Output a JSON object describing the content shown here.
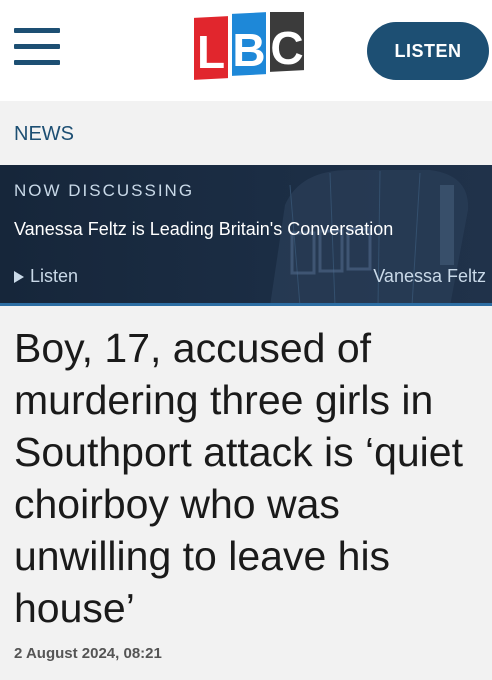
{
  "header": {
    "logo_letters": [
      "L",
      "B",
      "C"
    ],
    "listen_label": "LISTEN",
    "brand_colors": {
      "l": "#e1262d",
      "b": "#1e88d8",
      "c": "#3b3b3b",
      "primary": "#1d4f73"
    },
    "menu_icon": "hamburger-menu-icon"
  },
  "nav": {
    "section_label": "NEWS"
  },
  "now_discussing": {
    "label": "NOW DISCUSSING",
    "title": "Vanessa Feltz is Leading Britain's Conversation",
    "listen_label": "Listen",
    "listen_icon": "play-icon",
    "presenter": "Vanessa Feltz"
  },
  "article": {
    "headline": "Boy, 17, accused of murdering three girls in Southport attack is ‘quiet choirboy who was unwilling to leave his house’",
    "date": "2 August 2024, 08:21"
  }
}
